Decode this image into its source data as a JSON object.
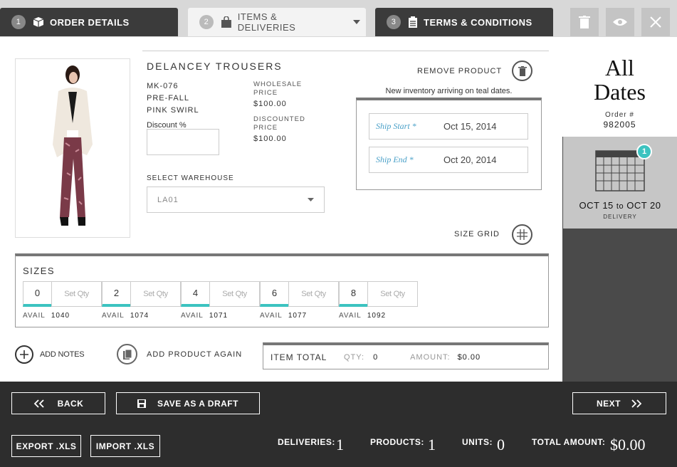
{
  "tabs": [
    {
      "num": "1",
      "label": "ORDER DETAILS"
    },
    {
      "num": "2",
      "label": "ITEMS & DELIVERIES"
    },
    {
      "num": "3",
      "label": "TERMS & CONDITIONS"
    }
  ],
  "product": {
    "name": "DELANCEY TROUSERS",
    "sku": "MK-076",
    "season": "PRE-FALL",
    "color": "PINK SWIRL",
    "wholesale_label": "WHOLESALE PRICE",
    "wholesale_price": "$100.00",
    "discounted_label": "DISCOUNTED PRICE",
    "discounted_price": "$100.00",
    "discount_label": "Discount %",
    "discount_value": "",
    "warehouse_label": "SELECT WAREHOUSE",
    "warehouse_value": "LA01",
    "remove_label": "REMOVE PRODUCT",
    "inventory_note": "New inventory arriving on teal dates.",
    "ship_start_label": "Ship Start *",
    "ship_start_value": "Oct 15, 2014",
    "ship_end_label": "Ship End *",
    "ship_end_value": "Oct 20, 2014",
    "size_grid_label": "SIZE GRID"
  },
  "sizes": {
    "title": "SIZES",
    "set_qty_label": "Set Qty",
    "avail_label": "AVAIL",
    "items": [
      {
        "qty": "0",
        "avail": "1040"
      },
      {
        "qty": "2",
        "avail": "1074"
      },
      {
        "qty": "4",
        "avail": "1071"
      },
      {
        "qty": "6",
        "avail": "1077"
      },
      {
        "qty": "8",
        "avail": "1092"
      }
    ]
  },
  "actions": {
    "add_notes": "ADD NOTES",
    "add_again": "ADD PRODUCT AGAIN"
  },
  "item_total": {
    "label": "ITEM TOTAL",
    "qty_label": "QTY:",
    "qty": "0",
    "amount_label": "AMOUNT:",
    "amount": "$0.00"
  },
  "sidebar": {
    "title_line1": "All",
    "title_line2": "Dates",
    "order_label": "Order #",
    "order_number": "982005",
    "badge": "1",
    "delivery_start": "OCT 15",
    "delivery_to": "to",
    "delivery_end": "OCT 20",
    "delivery_label": "DELIVERY"
  },
  "footer": {
    "back": "BACK",
    "save_draft": "SAVE AS A DRAFT",
    "next": "NEXT",
    "export": "EXPORT .XLS",
    "import": "IMPORT .XLS",
    "deliveries_label": "DELIVERIES:",
    "deliveries": "1",
    "products_label": "PRODUCTS:",
    "products": "1",
    "units_label": "UNITS:",
    "units": "0",
    "total_label": "TOTAL AMOUNT:",
    "total": "$0.00"
  },
  "colors": {
    "accent": "#3cc3c0",
    "dark": "#2d2d2d"
  }
}
